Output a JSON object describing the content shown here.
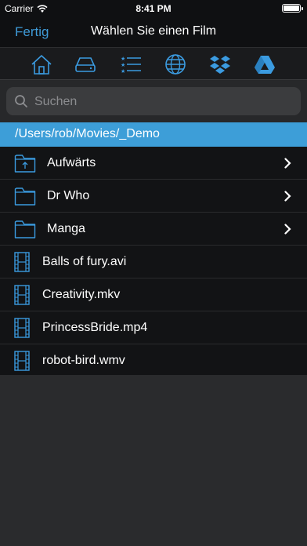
{
  "status": {
    "carrier": "Carrier",
    "time": "8:41 PM",
    "battery_level": 1.0
  },
  "nav": {
    "done_label": "Fertig",
    "title": "Wählen Sie einen Film"
  },
  "sources": [
    {
      "icon": "home-icon"
    },
    {
      "icon": "drive-icon"
    },
    {
      "icon": "playlist-icon"
    },
    {
      "icon": "globe-icon"
    },
    {
      "icon": "dropbox-icon"
    },
    {
      "icon": "google-drive-icon"
    }
  ],
  "search": {
    "placeholder": "Suchen",
    "value": ""
  },
  "path": "/Users/rob/Movies/_Demo",
  "items": [
    {
      "type": "folder-up",
      "label": "Aufwärts",
      "chevron": true
    },
    {
      "type": "folder",
      "label": "Dr Who",
      "chevron": true
    },
    {
      "type": "folder",
      "label": "Manga",
      "chevron": true
    },
    {
      "type": "video",
      "label": "Balls of fury.avi",
      "chevron": false
    },
    {
      "type": "video",
      "label": "Creativity.mkv",
      "chevron": false
    },
    {
      "type": "video",
      "label": "PrincessBride.mp4",
      "chevron": false
    },
    {
      "type": "video",
      "label": "robot-bird.wmv",
      "chevron": false
    }
  ],
  "colors": {
    "accent": "#3f9bd8",
    "path_bar": "#3d9ed8",
    "icon_blue": "#3b9be0"
  }
}
